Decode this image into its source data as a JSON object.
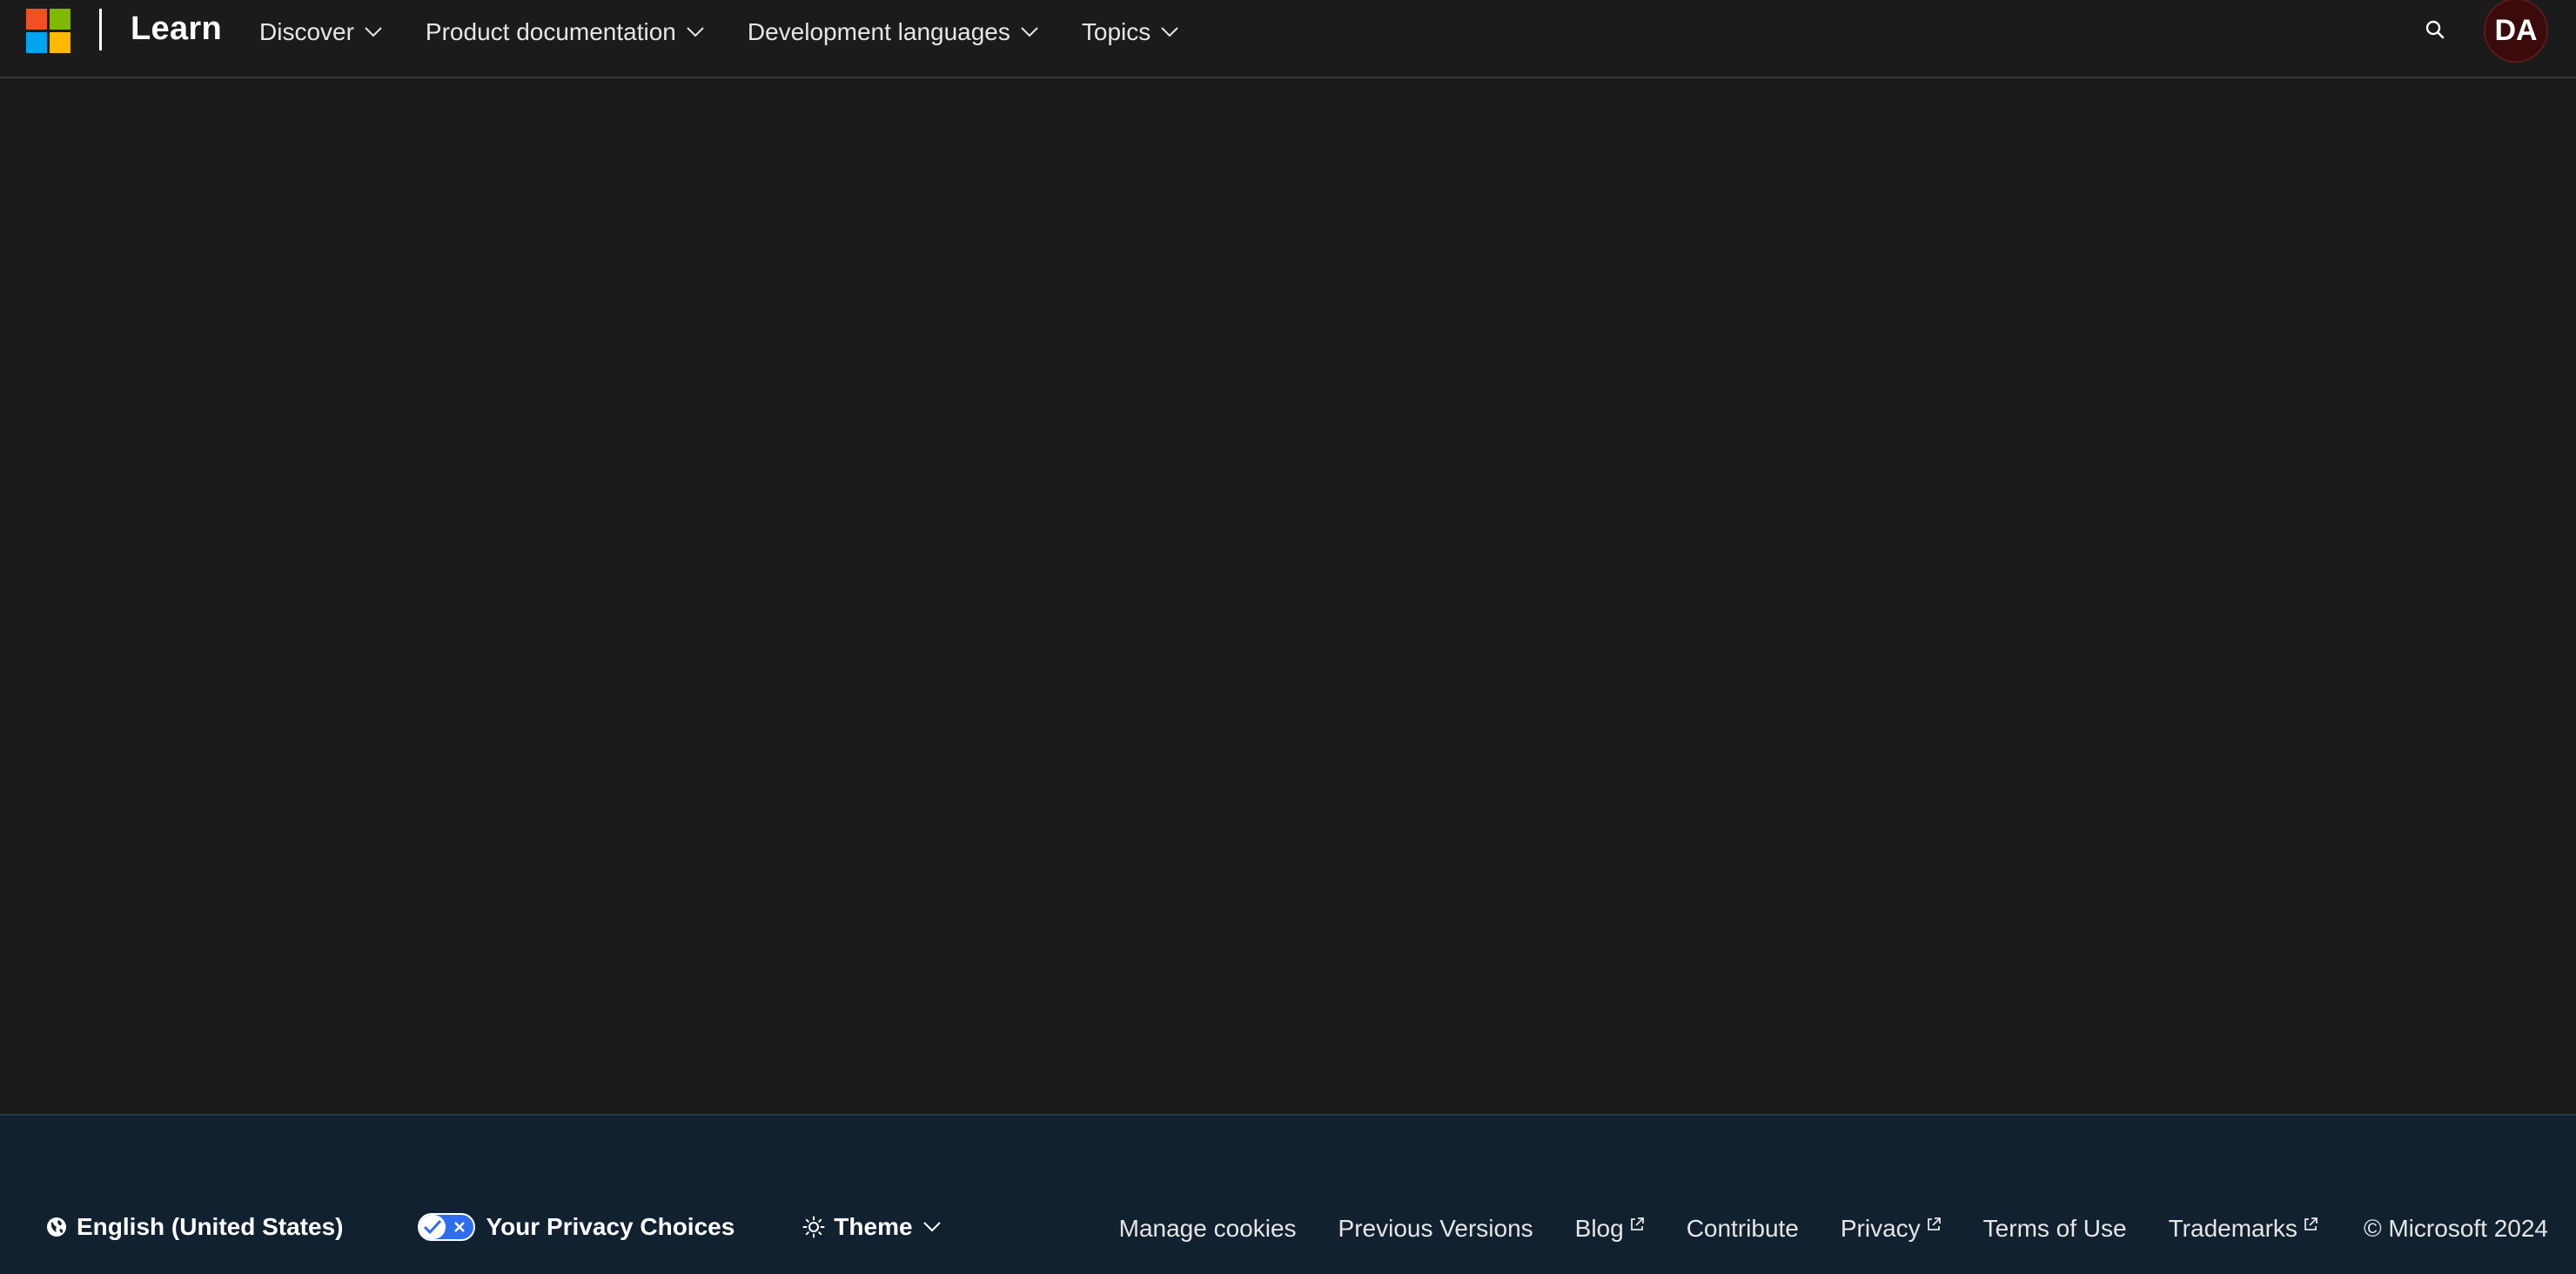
{
  "colors": {
    "page_background": "#1a1a1a",
    "footer_background": "#112130",
    "avatar_background": "#3b0a0a",
    "privacy_toggle": "#2f6df0",
    "ms_logo": [
      "#f25022",
      "#7fba00",
      "#00a4ef",
      "#ffb900"
    ]
  },
  "header": {
    "brand": "Learn",
    "nav": [
      {
        "label": "Discover",
        "icon": "chevron-down-icon"
      },
      {
        "label": "Product documentation",
        "icon": "chevron-down-icon"
      },
      {
        "label": "Development languages",
        "icon": "chevron-down-icon"
      },
      {
        "label": "Topics",
        "icon": "chevron-down-icon"
      }
    ],
    "search_icon": "search-icon",
    "avatar_initials": "DA"
  },
  "footer": {
    "locale": {
      "label": "English (United States)",
      "icon": "globe-icon"
    },
    "privacy_choices": {
      "label": "Your Privacy Choices",
      "icon": "privacy-toggle-icon"
    },
    "theme": {
      "label": "Theme",
      "icon": "sun-icon"
    },
    "links": [
      {
        "label": "Manage cookies",
        "external": false
      },
      {
        "label": "Previous Versions",
        "external": false
      },
      {
        "label": "Blog",
        "external": true
      },
      {
        "label": "Contribute",
        "external": false
      },
      {
        "label": "Privacy",
        "external": true
      },
      {
        "label": "Terms of Use",
        "external": false
      },
      {
        "label": "Trademarks",
        "external": true
      }
    ],
    "copyright": "© Microsoft 2024"
  }
}
